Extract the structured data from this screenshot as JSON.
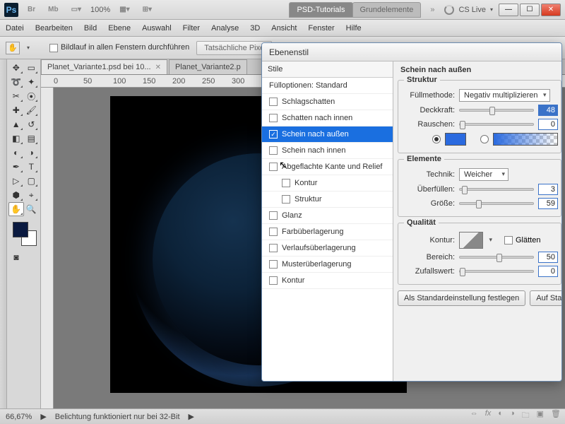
{
  "topstrip": {
    "zoom": "100%",
    "ws_tabs": [
      "PSD-Tutorials",
      "Grundelemente"
    ],
    "cs_live": "CS Live"
  },
  "menubar": [
    "Datei",
    "Bearbeiten",
    "Bild",
    "Ebene",
    "Auswahl",
    "Filter",
    "Analyse",
    "3D",
    "Ansicht",
    "Fenster",
    "Hilfe"
  ],
  "optbar": {
    "scroll_all": "Bildlauf in allen Fenstern durchführen",
    "actual_pixels": "Tatsächliche Pixe"
  },
  "doc_tabs": [
    "Planet_Variante1.psd bei 10...",
    "Planet_Variante2.p"
  ],
  "ruler_marks": [
    "0",
    "50",
    "100",
    "150",
    "200",
    "250",
    "300"
  ],
  "statusbar": {
    "zoom": "66,67%",
    "msg": "Belichtung funktioniert nur bei 32-Bit"
  },
  "dialog": {
    "title": "Ebenenstil",
    "styles_header": "Stile",
    "blend_options": "Fülloptionen: Standard",
    "items": [
      {
        "label": "Schlagschatten",
        "checked": false
      },
      {
        "label": "Schatten nach innen",
        "checked": false
      },
      {
        "label": "Schein nach außen",
        "checked": true,
        "selected": true
      },
      {
        "label": "Schein nach innen",
        "checked": false
      },
      {
        "label": "Abgeflachte Kante und Relief",
        "checked": false
      },
      {
        "label": "Kontur",
        "checked": false,
        "sub": true
      },
      {
        "label": "Struktur",
        "checked": false,
        "sub": true
      },
      {
        "label": "Glanz",
        "checked": false
      },
      {
        "label": "Farbüberlagerung",
        "checked": false
      },
      {
        "label": "Verlaufsüberlagerung",
        "checked": false
      },
      {
        "label": "Musterüberlagerung",
        "checked": false
      },
      {
        "label": "Kontur",
        "checked": false
      }
    ],
    "panel_title": "Schein nach außen",
    "struct_legend": "Struktur",
    "fill_method_lbl": "Füllmethode:",
    "fill_method_val": "Negativ multiplizieren",
    "opacity_lbl": "Deckkraft:",
    "opacity_val": "48",
    "noise_lbl": "Rauschen:",
    "noise_val": "0",
    "elements_legend": "Elemente",
    "technique_lbl": "Technik:",
    "technique_val": "Weicher",
    "spread_lbl": "Überfüllen:",
    "spread_val": "3",
    "size_lbl": "Größe:",
    "size_val": "59",
    "quality_legend": "Qualität",
    "contour_lbl": "Kontur:",
    "antialias_lbl": "Glätten",
    "range_lbl": "Bereich:",
    "range_val": "50",
    "jitter_lbl": "Zufallswert:",
    "jitter_val": "0",
    "btn_default": "Als Standardeinstellung festlegen",
    "btn_reset": "Auf Stan"
  }
}
